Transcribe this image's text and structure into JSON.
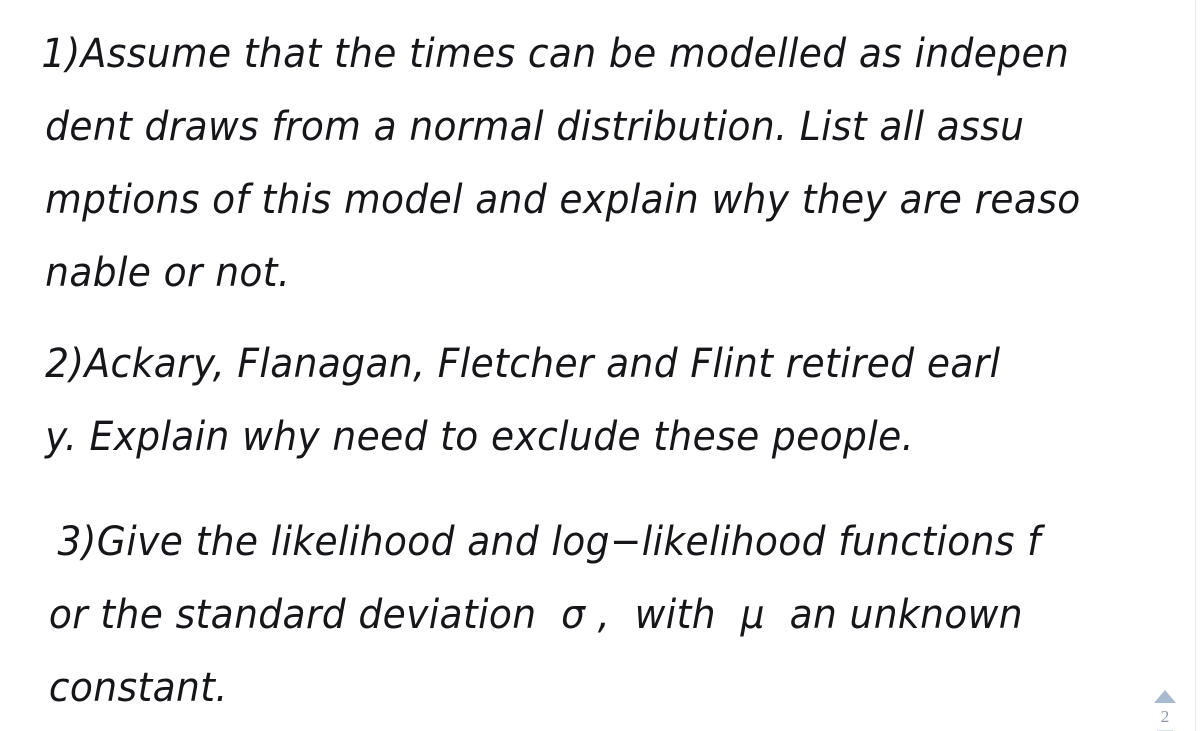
{
  "document": {
    "background_color": "#ffffff",
    "ink_color": "#15161a",
    "paragraphs": [
      {
        "id": "question-1",
        "lines": [
          "1)Assume that the times can be modelled as indepen",
          "dent draws from a normal distribution. List all assu",
          "mptions of this model and explain why they are reaso",
          "nable or not."
        ]
      },
      {
        "id": "question-2",
        "lines": [
          "2)Ackary, Flanagan, Fletcher and Flint retired earl",
          "y. Explain why need to exclude these people."
        ]
      },
      {
        "id": "question-3",
        "lines": [
          " 3)Give the likelihood and log−likelihood functions f",
          "or the standard deviation  σ ,  with  μ  an unknown",
          "constant."
        ]
      }
    ]
  },
  "page_nav": {
    "scroll_up_icon": "triangle-up-icon",
    "page_number": "2",
    "arrow_color": "#a8bad2",
    "number_color": "#8e99ab"
  }
}
